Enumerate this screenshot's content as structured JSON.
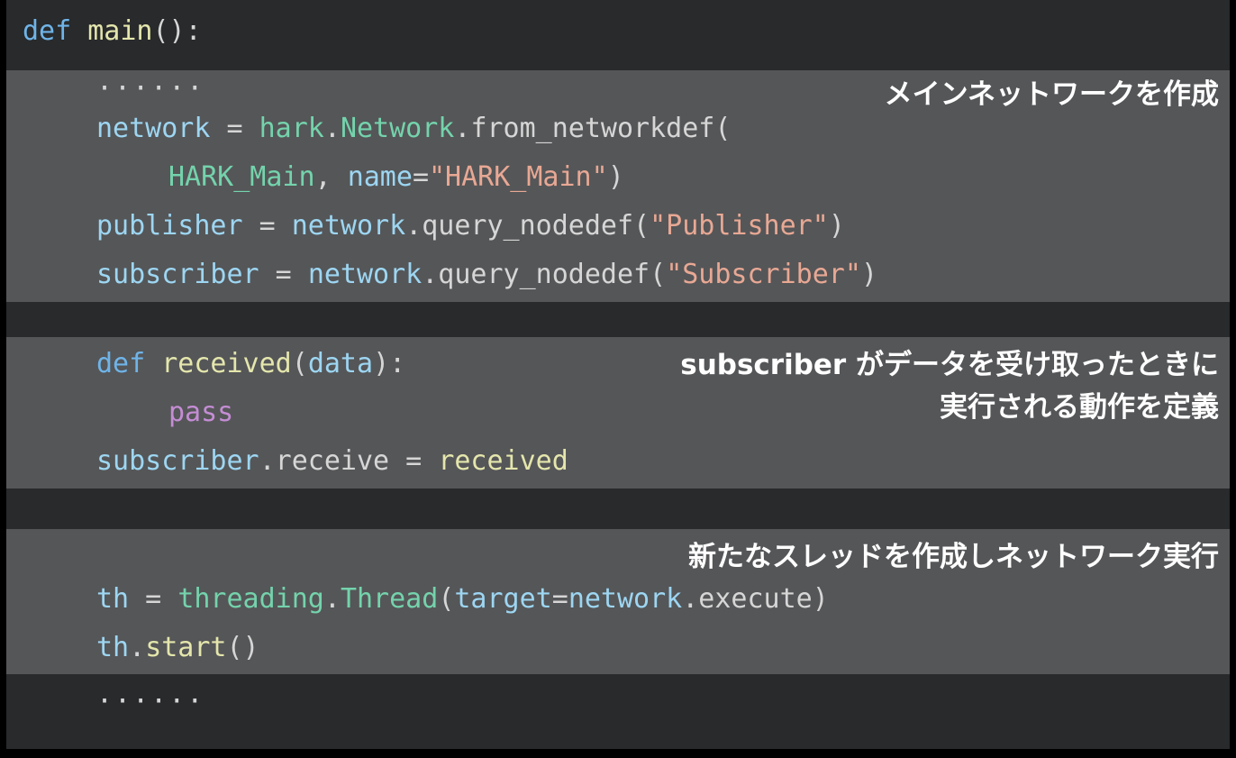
{
  "slide": {
    "background_color": "#000000",
    "code_background_color": "#282a2c",
    "highlight_band_color": "#555658"
  },
  "palette": {
    "keyword": "#6fb4e8",
    "function": "#e4e6ac",
    "identifier": "#9dd6f2",
    "module": "#74d3ac",
    "string": "#e8a894",
    "builtin": "#c48dd4",
    "plain": "#d6d6d6",
    "annotation": "#ffffff"
  },
  "code": {
    "language": "python",
    "lines": [
      {
        "id": "l01",
        "kw": "def",
        "fn": "main",
        "tail": "():"
      },
      {
        "id": "l02",
        "dots": "······"
      },
      {
        "id": "l03",
        "var": "network",
        "eq": " = ",
        "mod": "hark",
        "dot": ".",
        "mod2": "Network",
        "dot2": ".",
        "plain": "from_networkdef("
      },
      {
        "id": "l04",
        "mod": "HARK_Main",
        "plain": ", ",
        "var": "name",
        "eq": "=",
        "str": "\"HARK_Main\"",
        "tail": ")"
      },
      {
        "id": "l05",
        "var": "publisher",
        "eq": " = ",
        "var2": "network",
        "plain": ".query_nodedef(",
        "str": "\"Publisher\"",
        "tail": ")"
      },
      {
        "id": "l06",
        "var": "subscriber",
        "eq": " = ",
        "var2": "network",
        "plain": ".query_nodedef(",
        "str": "\"Subscriber\"",
        "tail": ")"
      },
      {
        "id": "l07",
        "kw": "def",
        "fn": "received",
        "plain": "(",
        "var": "data",
        "tail": "):"
      },
      {
        "id": "l08",
        "bi": "pass"
      },
      {
        "id": "l09",
        "var": "subscriber",
        "plain": ".receive = ",
        "fn": "received"
      },
      {
        "id": "l10",
        "var": "th",
        "eq": " = ",
        "mod": "threading",
        "dot": ".",
        "mod2": "Thread",
        "plain": "(",
        "var2": "target",
        "eq2": "=",
        "var3": "network",
        "plain2": ".execute",
        "tail": ")"
      },
      {
        "id": "l11",
        "var": "th",
        "plain": ".",
        "fn": "start",
        "tail": "()"
      },
      {
        "id": "l12",
        "dots": "······"
      }
    ],
    "raw_text": [
      "def main():",
      "    ······",
      "    network = hark.Network.from_networkdef(",
      "        HARK_Main, name=\"HARK_Main\")",
      "    publisher = network.query_nodedef(\"Publisher\")",
      "    subscriber = network.query_nodedef(\"Subscriber\")",
      "",
      "    def received(data):",
      "        pass",
      "    subscriber.receive = received",
      "",
      "    th = threading.Thread(target=network.execute)",
      "    th.start()",
      "    ······"
    ]
  },
  "annotations": {
    "note1": "メインネットワークを作成",
    "note2": "subscriber がデータを受け取ったときに\n実行される動作を定義",
    "note3": "新たなスレッドを作成しネットワーク実行"
  },
  "tokens": {
    "def": "def",
    "main": "main",
    "main_tail": "():",
    "dots": "······",
    "network": "network",
    "assign_spaced": " = ",
    "hark": "hark",
    "dot": ".",
    "Network": "Network",
    "from_networkdef": "from_networkdef(",
    "HARK_Main_arg": "HARK_Main",
    "comma_sp": ", ",
    "name": "name",
    "eq": "=",
    "HARK_Main_str": "\"HARK_Main\"",
    "rparen": ")",
    "publisher": "publisher",
    "query_nodedef": ".query_nodedef(",
    "Publisher_str": "\"Publisher\"",
    "subscriber": "subscriber",
    "Subscriber_str": "\"Subscriber\"",
    "received": "received",
    "lparen": "(",
    "data": "data",
    "received_tail": "):",
    "pass": "pass",
    "receive_assign": ".receive = ",
    "th": "th",
    "threading": "threading",
    "Thread": "Thread",
    "target": "target",
    "execute": ".execute",
    "dot_only": ".",
    "start": "start",
    "start_tail": "()"
  }
}
